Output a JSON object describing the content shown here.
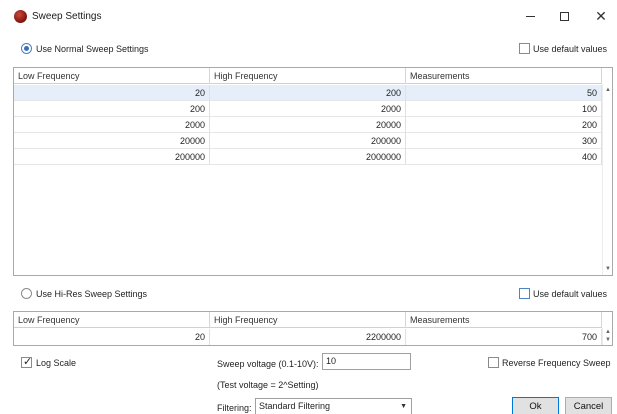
{
  "window": {
    "title": "Sweep Settings",
    "minimize": "–",
    "close": "✕"
  },
  "normal": {
    "radio_label": "Use Normal Sweep Settings",
    "default_label": "Use default values",
    "columns": [
      "Low Frequency",
      "High Frequency",
      "Measurements"
    ],
    "rows": [
      [
        "20",
        "200",
        "50"
      ],
      [
        "200",
        "2000",
        "100"
      ],
      [
        "2000",
        "20000",
        "200"
      ],
      [
        "20000",
        "200000",
        "300"
      ],
      [
        "200000",
        "2000000",
        "400"
      ]
    ]
  },
  "hires": {
    "radio_label": "Use Hi-Res Sweep Settings",
    "default_label": "Use default values",
    "columns": [
      "Low Frequency",
      "High Frequency",
      "Measurements"
    ],
    "row": [
      "20",
      "2200000",
      "700"
    ]
  },
  "options": {
    "log_scale": "Log Scale",
    "sweep_voltage_label": "Sweep voltage (0.1-10V):",
    "sweep_voltage_value": "10",
    "test_voltage_note": "(Test voltage = 2^Setting)",
    "reverse_label": "Reverse Frequency Sweep",
    "filtering_label": "Filtering:",
    "filtering_value": "Standard Filtering"
  },
  "buttons": {
    "ok": "Ok",
    "cancel": "Cancel"
  },
  "colors": {
    "selected_row": "#e5eef9",
    "radio_accent": "#3b6fb8",
    "default_button_border": "#0078d7"
  }
}
